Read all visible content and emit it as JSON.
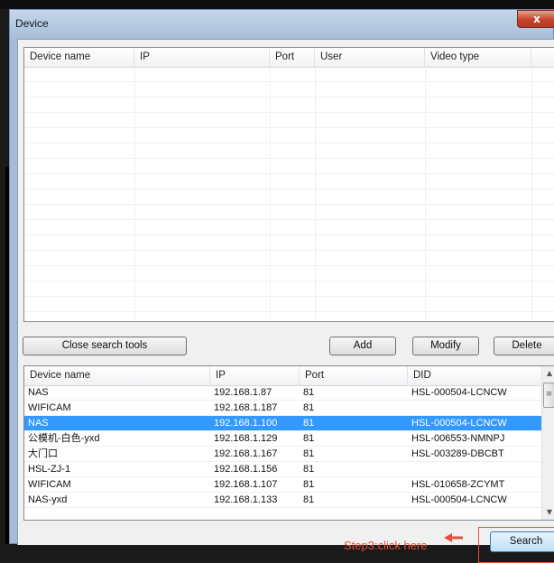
{
  "window": {
    "title": "Device",
    "close_label": "x"
  },
  "devices_table": {
    "columns": [
      "Device name",
      "IP",
      "Port",
      "User",
      "Video type"
    ],
    "rows": []
  },
  "buttons": {
    "close_search_tools": "Close search tools",
    "add": "Add",
    "modify": "Modify",
    "delete": "Delete",
    "search": "Search"
  },
  "search_table": {
    "columns": [
      "Device name",
      "IP",
      "Port",
      "DID"
    ],
    "rows": [
      {
        "name": "NAS",
        "ip": "192.168.1.87",
        "port": "81",
        "did": "HSL-000504-LCNCW"
      },
      {
        "name": "WIFICAM",
        "ip": "192.168.1.187",
        "port": "81",
        "did": ""
      },
      {
        "name": "NAS",
        "ip": "192.168.1.100",
        "port": "81",
        "did": "HSL-000504-LCNCW"
      },
      {
        "name": "公模机-白色-yxd",
        "ip": "192.168.1.129",
        "port": "81",
        "did": "HSL-006553-NMNPJ"
      },
      {
        "name": "大门口",
        "ip": "192.168.1.167",
        "port": "81",
        "did": "HSL-003289-DBCBT"
      },
      {
        "name": "HSL-ZJ-1",
        "ip": "192.168.1.156",
        "port": "81",
        "did": ""
      },
      {
        "name": "WIFICAM",
        "ip": "192.168.1.107",
        "port": "81",
        "did": "HSL-010658-ZCYMT"
      },
      {
        "name": "NAS-yxd",
        "ip": "192.168.1.133",
        "port": "81",
        "did": "HSL-000504-LCNCW"
      }
    ],
    "selected_index": 2
  },
  "annotation": {
    "text": "Step3:click here",
    "color": "#e8503a"
  },
  "icons": {
    "close": "close-icon",
    "scroll_up": "scroll-up-icon",
    "scroll_down": "scroll-down-icon"
  }
}
